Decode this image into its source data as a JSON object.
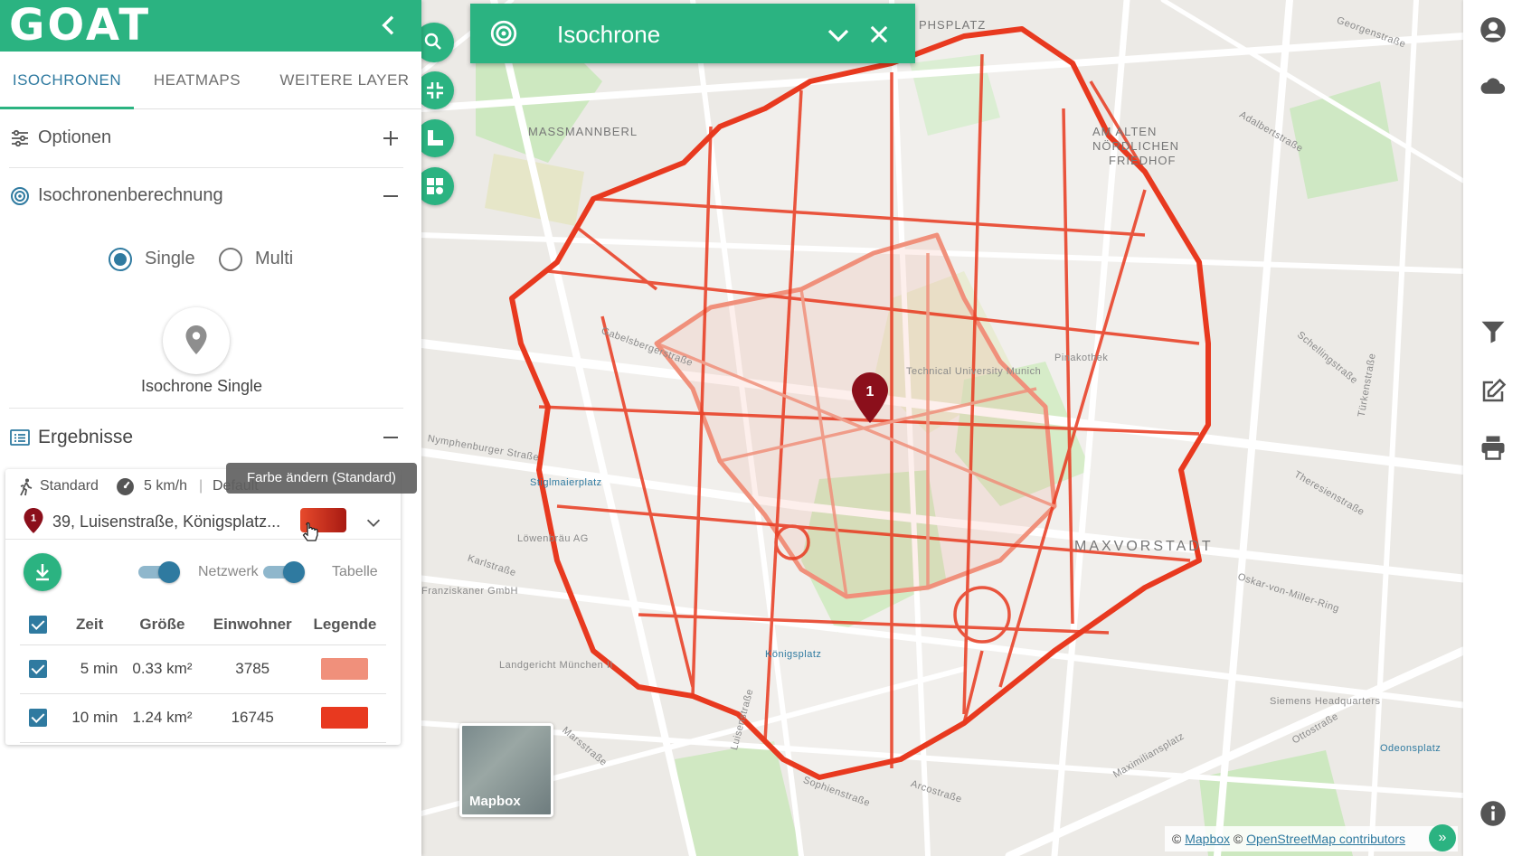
{
  "app": {
    "logo": "GOAT"
  },
  "tabs": [
    {
      "label": "ISOCHRONEN",
      "active": true
    },
    {
      "label": "HEATMAPS"
    },
    {
      "label": "WEITERE LAYER"
    }
  ],
  "sections": {
    "options": {
      "title": "Optionen",
      "action": "plus-icon"
    },
    "calc": {
      "title": "Isochronenberechnung",
      "action": "minus-icon"
    },
    "results": {
      "title": "Ergebnisse",
      "action": "minus-icon"
    }
  },
  "calc_mode": {
    "options": [
      "Single",
      "Multi"
    ],
    "selected": "Single"
  },
  "start_point": {
    "label": "Isochrone Single"
  },
  "result_card": {
    "mode": "Standard",
    "speed": "5 km/h",
    "profile": "Default",
    "address": "39, Luisenstraße, Königsplatz...",
    "marker_number": "1",
    "tooltip": "Farbe ändern (Standard)",
    "toggles": [
      {
        "label": "Netzwerk",
        "on": true
      },
      {
        "label": "Tabelle",
        "on": true
      }
    ],
    "table": {
      "headers": [
        "Zeit",
        "Größe",
        "Einwohner",
        "Legende"
      ],
      "rows": [
        {
          "zeit": "5 min",
          "groesse": "0.33 km²",
          "einwohner": "3785",
          "color": "#f0907b",
          "checked": true
        },
        {
          "zeit": "10 min",
          "groesse": "1.24 km²",
          "einwohner": "16745",
          "color": "#e8391f",
          "checked": true
        }
      ]
    }
  },
  "map": {
    "panel_title": "Isochrone",
    "marker": "1",
    "minimap_label": "Mapbox",
    "attribution": {
      "mapbox": "Mapbox",
      "osm": "OpenStreetMap contributors",
      "sep": "©"
    },
    "labels": [
      "MASSMANNBERL",
      "AM ALTEN",
      "NÖRDLICHEN",
      "FRIEDHOF",
      "MAXVORSTADT",
      "Gabelsbergerstraße",
      "Nymphenburger Straße",
      "Karlstraße",
      "Königsplatz",
      "Technical University Munich",
      "Pinakothek",
      "Schellingstraße",
      "Theresienstraße",
      "Marsstraße",
      "Arcostraße",
      "Oskar-von-Miller-Ring",
      "Türkenstraße",
      "Adalbertstraße",
      "Georgenstraße",
      "PHSPLATZ",
      "Sophienstraße",
      "Luisenstraße",
      "Maximiliansplatz",
      "Ottostraße",
      "Siemens Headquarters",
      "Odeonsplatz",
      "Landgericht München II",
      "Franziskaner GmbH",
      "Löwenbräu AG",
      "Stiglmaierplatz"
    ]
  },
  "colors": {
    "brand": "#2bb381",
    "accent": "#2f7aa0",
    "iso_10": "#e8391f",
    "iso_5": "#f0907b"
  }
}
